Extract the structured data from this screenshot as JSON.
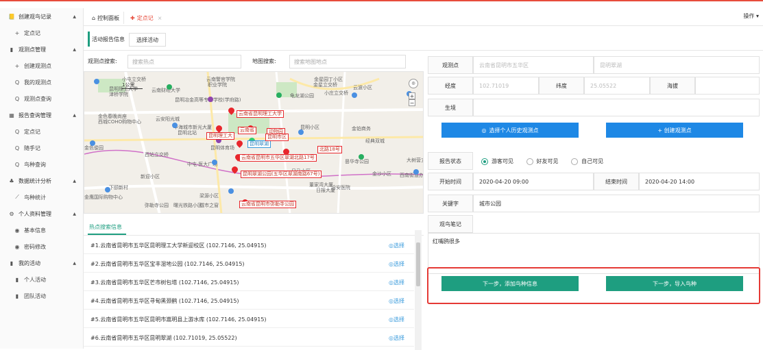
{
  "sidebar": {
    "items": [
      {
        "label": "创建观鸟记录",
        "icon": "📒",
        "sec": true
      },
      {
        "label": "定点记",
        "icon": "+"
      },
      {
        "label": "观测点管理",
        "icon": "▮",
        "sec": true
      },
      {
        "label": "创建观测点",
        "icon": "+"
      },
      {
        "label": "我的观测点",
        "icon": "Q"
      },
      {
        "label": "观测点查询",
        "icon": "Q"
      },
      {
        "label": "报告查询管理",
        "icon": "▦",
        "sec": true
      },
      {
        "label": "定点记",
        "icon": "Q"
      },
      {
        "label": "随手记",
        "icon": "Q"
      },
      {
        "label": "鸟种查询",
        "icon": "Q"
      },
      {
        "label": "数据统计分析",
        "icon": "♣",
        "sec": true
      },
      {
        "label": "鸟种统计",
        "icon": "⟋"
      },
      {
        "label": "个人资料管理",
        "icon": "⚙",
        "sec": true
      },
      {
        "label": "基本信息",
        "icon": "◉"
      },
      {
        "label": "密码修改",
        "icon": "◉"
      },
      {
        "label": "我的活动",
        "icon": "▮",
        "sec": true
      },
      {
        "label": "个人活动",
        "icon": "▮"
      },
      {
        "label": "团队活动",
        "icon": "▮"
      }
    ]
  },
  "tabs": {
    "home": "控制面板",
    "active": "定点记",
    "close": "×",
    "ops": "操作 ▾"
  },
  "subbar": {
    "label": "活动报告信息",
    "button": "选择活动"
  },
  "search": {
    "point_label": "观测点搜索:",
    "point_placeholder": "搜索热点",
    "map_label": "地图搜索:",
    "map_placeholder": "搜索地图地点"
  },
  "map": {
    "scale": "1公里",
    "labels": [
      "小屯立交桥",
      "昆明理工大学",
      "津桥学院",
      "云南财经大学",
      "云南警官学院",
      "职业学院",
      "金星园丁小区",
      "金星立交桥",
      "小庄立交桥",
      "云波小区",
      "龟龙湖公园",
      "昆明冶金高等专科学校(学府路)",
      "金色春晚尚座",
      "西城COHO购物中心",
      "云安阳光城",
      "华海城市新光大厦",
      "昆明北站",
      "昆明小区",
      "金铂商务",
      "金色俊园",
      "经典双城",
      "西站立交桥",
      "昆明体育场",
      "中屯·医大广场",
      "新迎小区",
      "昙华寺公园",
      "大树营立交桥",
      "金沙小区",
      "西南街道办事处",
      "下颐新村",
      "金鹰国际购物中心",
      "董家湾大厦",
      "日报大厦",
      "沿安医院",
      "梁源小区",
      "日马小区",
      "弥勒寺公园",
      "曙光铁路小区",
      "城市之窗"
    ],
    "pins": [
      "云南省昆明理工大学",
      "昆明理工大",
      "云南省",
      "动物园",
      "昆明翠湖",
      "昆明市区",
      "北路18号",
      "云南省昆明市五华区翠湖北路17号",
      "昆明翠湖公园(五华区翠湖南路67号)",
      "云南省昆明市弥勒寺公园"
    ]
  },
  "hot": {
    "title": "热点搜索信息",
    "pick": "选择",
    "rows": [
      "#1.云南省昆明市五华区昆明理工大学新迎校区 (102.7146, 25.04915)",
      "#2.云南省昆明市五华区宝丰湿地公园 (102.7146, 25.04915)",
      "#3.云南省昆明市五华区芒市树包塔 (102.7146, 25.04915)",
      "#4.云南省昆明市五华区寻甸黑颈鹤 (102.7146, 25.04915)",
      "#5.云南省昆明市五华区昆明市嵩明县上游水库 (102.7146, 25.04915)",
      "#6.云南省昆明市五华区昆明翠湖 (102.71019, 25.05522)"
    ]
  },
  "form": {
    "point_label": "观测点",
    "point_value": "云南省昆明市五华区",
    "point_value2": "昆明翠湖",
    "lng_label": "经度",
    "lng_value": "102.71019",
    "lat_label": "纬度",
    "lat_value": "25.05522",
    "alt_label": "海拔",
    "habitat_label": "生境",
    "btn_history": "选择个人历史观测点",
    "btn_create": "+ 创建观测点",
    "status_label": "报告状态",
    "status_options": [
      "游客可见",
      "好友可见",
      "自己可见"
    ],
    "start_label": "开始时间",
    "start_value": "2020-04-20 09:00",
    "end_label": "结束时间",
    "end_value": "2020-04-20 14:00",
    "kw_label": "关键字",
    "kw_value": "城市公园",
    "note_label": "观鸟笔记",
    "note_value": "红嘴鸥很多",
    "btn_next1": "下一步，添加鸟种信息",
    "btn_next2": "下一步，导入鸟种"
  },
  "colors": {
    "accent": "#1e9e80",
    "blue": "#1e88e5",
    "red": "#e53935"
  }
}
